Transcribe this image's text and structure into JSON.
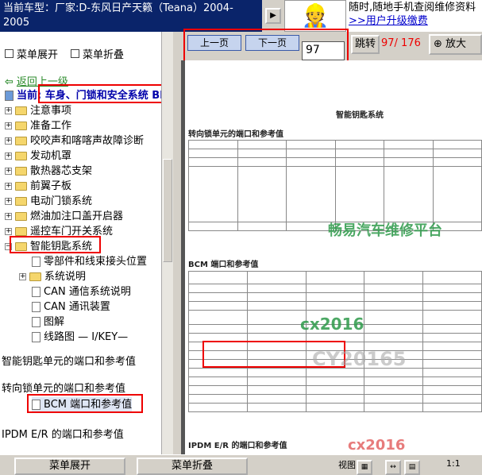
{
  "title": {
    "line1": "当前车型：厂家:D-东风日产天籁（Teana）2004-",
    "line2": "2005"
  },
  "ad": {
    "text": "随时,随地手机查阅维修资料",
    "link": ">>用户升级缴费"
  },
  "menu": {
    "expand": "菜单展开",
    "collapse": "菜单折叠"
  },
  "tree": {
    "back": "返回上一级",
    "current": "当前: 车身、门锁和安全系统 BL",
    "items": [
      "注意事项",
      "准备工作",
      "咬咬声和喀喀声故障诊断",
      "发动机罩",
      "散热器芯支架",
      "前翼子板",
      "电动门锁系统",
      "燃油加注口盖开启器",
      "遥控车门开关系统",
      "智能钥匙系统"
    ],
    "sub": [
      "零部件和线束接头位置",
      "系统说明",
      "CAN 通信系统说明",
      "CAN 通讯装置",
      "图解",
      "线路图 — I/KEY—",
      "智能钥匙单元的端口和参考值",
      "转向锁单元的端口和参考值",
      "BCM 端口和参考值",
      "IPDM E/R 的端口和参考值"
    ]
  },
  "toolbar": {
    "prev": "上一页",
    "next": "下一页",
    "page_value": "97",
    "go": "跳转",
    "page_info": "97/ 176",
    "zoom": "放大"
  },
  "doc": {
    "heading": "智能钥匙系统",
    "section1": "转向锁单元的端口和参考值",
    "section2": "BCM 端口和参考值",
    "section3": "IPDM E/R 的端口和参考值",
    "watermark1": "畅易汽车维修平台",
    "watermark2": "cx2016",
    "watermark3": "CY20165",
    "watermark4": "cx2016"
  },
  "bottom": {
    "expand": "菜单展开",
    "collapse": "菜单折叠",
    "view": "视图",
    "scale": "1:1"
  }
}
